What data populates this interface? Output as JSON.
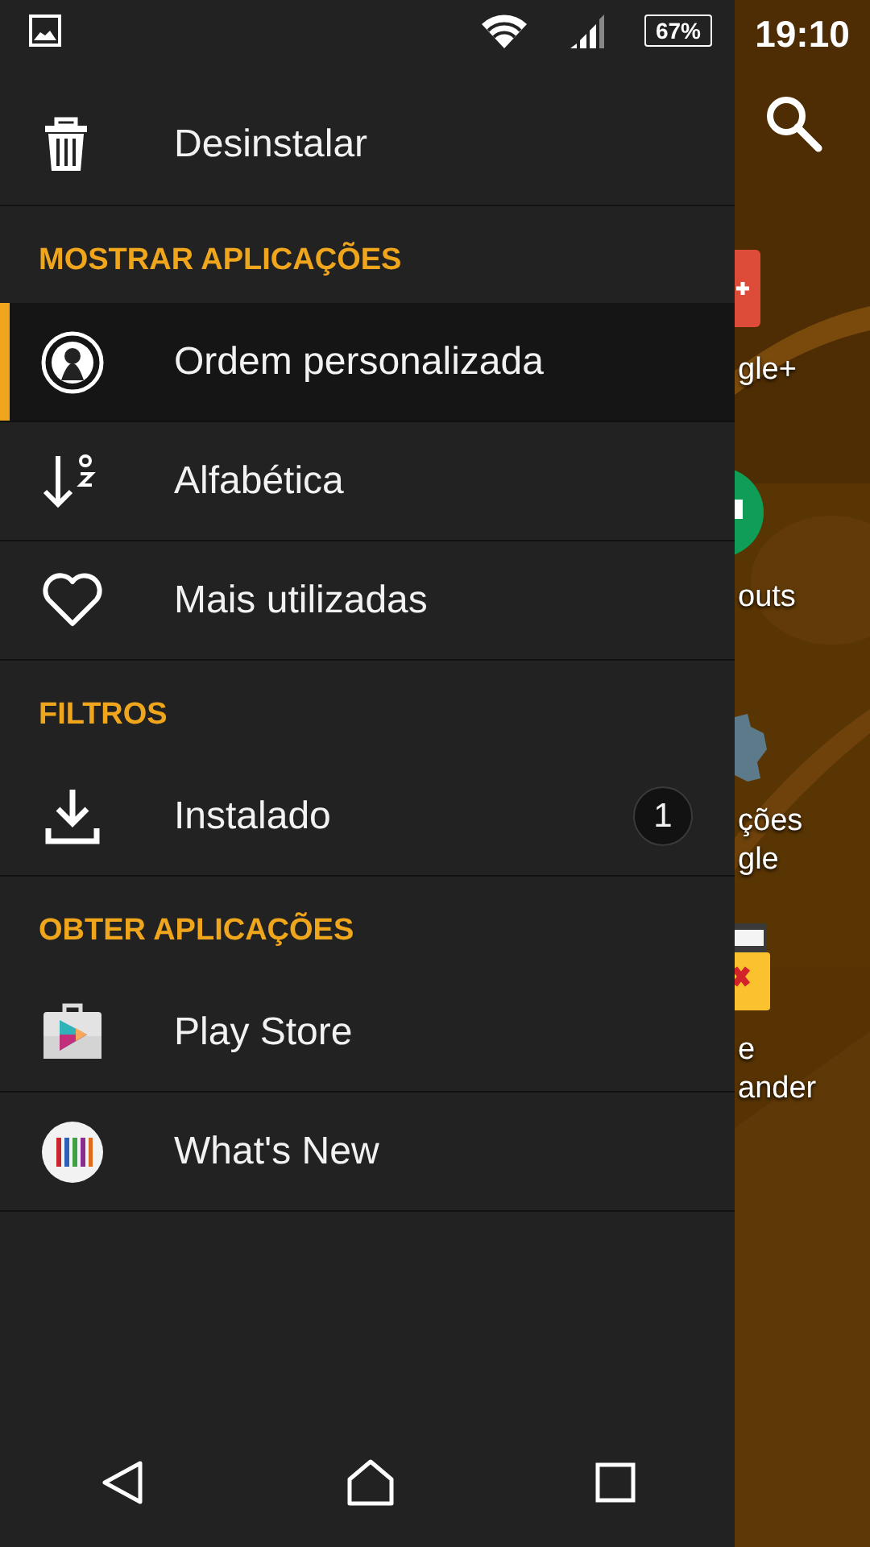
{
  "status_bar": {
    "battery": "67%",
    "time": "19:10"
  },
  "drawer": {
    "items": [
      {
        "kind": "entry",
        "label": "Desinstalar",
        "selected": false
      },
      {
        "kind": "header",
        "label": "MOSTRAR APLICAÇÕES"
      },
      {
        "kind": "entry",
        "label": "Ordem personalizada",
        "selected": true
      },
      {
        "kind": "entry",
        "label": "Alfabética",
        "selected": false
      },
      {
        "kind": "entry",
        "label": "Mais utilizadas",
        "selected": false
      },
      {
        "kind": "header",
        "label": "FILTROS"
      },
      {
        "kind": "entry",
        "label": "Instalado",
        "selected": false,
        "badge": "1"
      },
      {
        "kind": "header",
        "label": "OBTER APLICAÇÕES"
      },
      {
        "kind": "entry",
        "label": "Play Store",
        "selected": false
      },
      {
        "kind": "entry",
        "label": "What's New",
        "selected": false
      }
    ]
  },
  "home_screen": {
    "apps": [
      {
        "label_lines": [
          "gle+"
        ]
      },
      {
        "label_lines": [
          "outs"
        ]
      },
      {
        "label_lines": [
          "ções",
          "gle"
        ]
      },
      {
        "label_lines": [
          "e",
          "ander"
        ]
      }
    ]
  }
}
